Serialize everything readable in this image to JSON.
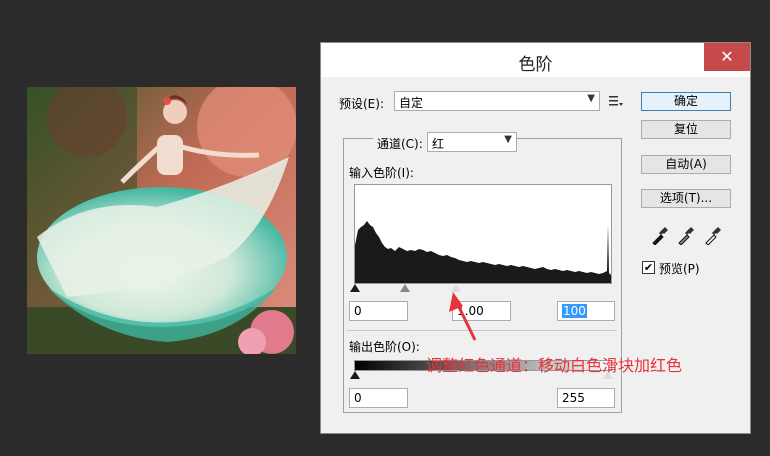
{
  "dialog": {
    "title": "色阶",
    "close_glyph": "✕",
    "preset_label": "预设(E):",
    "preset_value": "自定",
    "channel_label": "通道(C):",
    "channel_value": "红",
    "input_levels_label": "输入色阶(I):",
    "output_levels_label": "输出色阶(O):",
    "input_black": "0",
    "input_gamma": "1.00",
    "input_white": "100",
    "output_black": "0",
    "output_white": "255",
    "buttons": {
      "ok": "确定",
      "reset": "复位",
      "auto": "自动(A)",
      "options": "选项(T)..."
    },
    "preview_label": "预览(P)",
    "preview_checked": true,
    "check_glyph": "✔"
  },
  "annotation": {
    "text": "调整红色通道：移动白色滑块加红色",
    "color": "#e8333a"
  },
  "icons": {
    "preset_menu": "list-menu-icon",
    "eyedroppers": [
      "black-eyedropper-icon",
      "gray-eyedropper-icon",
      "white-eyedropper-icon"
    ]
  }
}
